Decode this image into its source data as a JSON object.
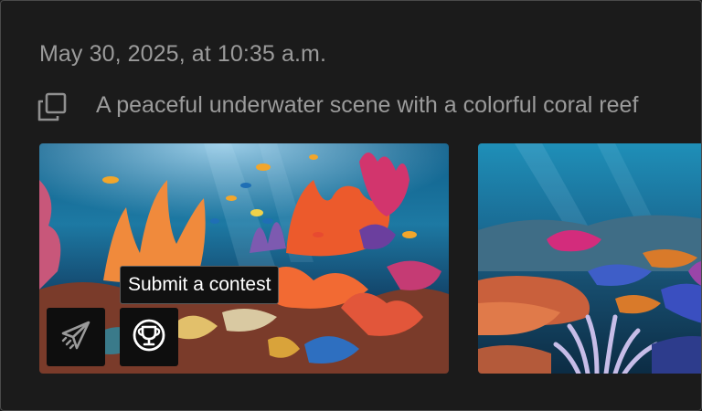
{
  "header": {
    "timestamp": "May 30, 2025, at 10:35 a.m."
  },
  "prompt": {
    "text": "A peaceful underwater scene with a colorful coral reef",
    "copy_icon": "copy-icon"
  },
  "gallery": {
    "images": [
      {
        "name": "coral-reef-image-1",
        "subject": "coral reef with orange corals and tropical fish"
      },
      {
        "name": "coral-reef-image-2",
        "subject": "coral reef with pink anemone and purple coral"
      }
    ]
  },
  "actions": {
    "share_icon": "paper-plane-icon",
    "contest_icon": "trophy-icon",
    "tooltip": "Submit a contest"
  },
  "colors": {
    "background": "#1b1b1b",
    "text_muted": "#9b9b9b",
    "button_bg": "#0e0e0e",
    "tooltip_bg": "#111111"
  }
}
